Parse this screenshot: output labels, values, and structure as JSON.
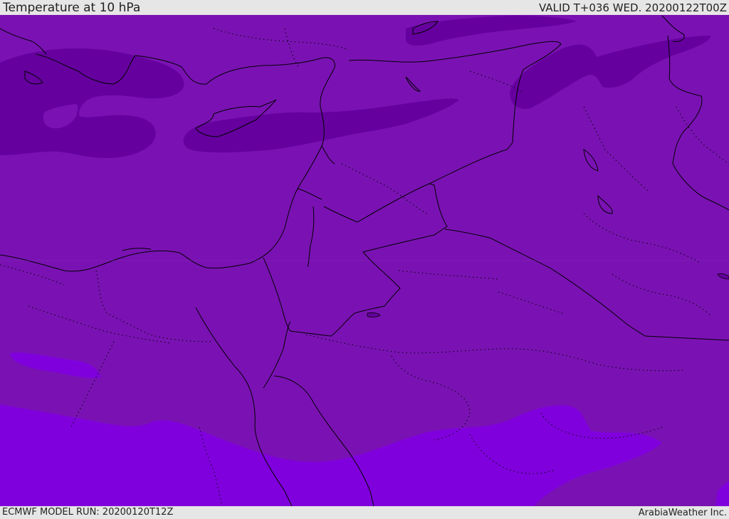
{
  "header": {
    "title": "Temperature at 10 hPa",
    "valid": "VALID T+036 WED. 20200122T00Z"
  },
  "footer": {
    "model_run": "ECMWF MODEL RUN: 20200120T12Z",
    "credit": "ArabiaWeather Inc."
  },
  "map": {
    "region": "Eastern Mediterranean and Middle East",
    "field": "temperature at 10 hPa",
    "colors": {
      "base_band": "#7a12b3",
      "cold_band": "#65009e",
      "warm_band": "#8000dd",
      "coastline": "#000000",
      "border": "#000000"
    },
    "layers": [
      "filled contours",
      "coastlines",
      "country borders",
      "admin borders (dotted)"
    ]
  }
}
